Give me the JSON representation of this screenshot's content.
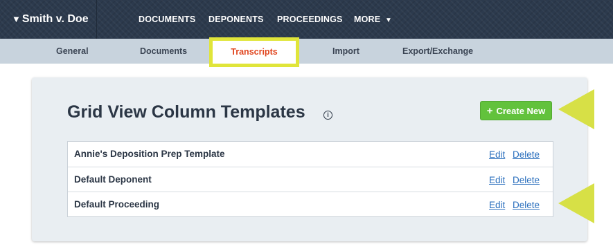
{
  "header": {
    "case_title": "Smith v. Doe",
    "nav": [
      "DOCUMENTS",
      "DEPONENTS",
      "PROCEEDINGS",
      "MORE"
    ]
  },
  "subnav": {
    "items": [
      "General",
      "Documents",
      "Transcripts",
      "Import",
      "Export/Exchange"
    ],
    "active": "Transcripts"
  },
  "panel": {
    "title": "Grid View Column Templates",
    "create_label": "Create New",
    "rows": [
      {
        "name": "Annie's Deposition Prep Template",
        "edit": "Edit",
        "delete": "Delete"
      },
      {
        "name": "Default Deponent",
        "edit": "Edit",
        "delete": "Delete"
      },
      {
        "name": "Default Proceeding",
        "edit": "Edit",
        "delete": "Delete"
      }
    ]
  },
  "colors": {
    "topbar": "#2c3a4d",
    "subnav": "#c8d3dd",
    "active_tab_text": "#e0451e",
    "highlight": "#e0e53a",
    "create_button": "#62c23c",
    "link": "#2a6fbd"
  },
  "icons": [
    "caret-down-icon",
    "info-icon",
    "plus-icon",
    "annotation-arrow-icon"
  ]
}
